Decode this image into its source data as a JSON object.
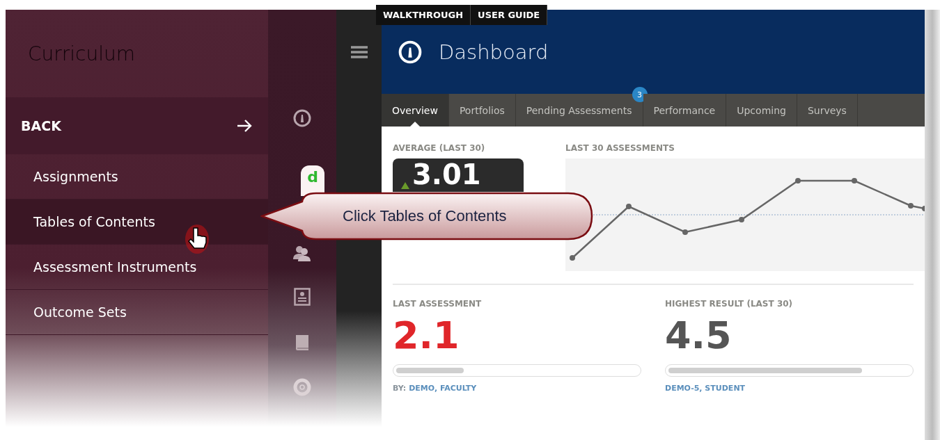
{
  "menu": {
    "title": "Curriculum",
    "back": "BACK",
    "items": [
      {
        "label": "Assignments",
        "selected": false
      },
      {
        "label": "Tables of Contents",
        "selected": true
      },
      {
        "label": "Assessment Instruments",
        "selected": false
      },
      {
        "label": "Outcome Sets",
        "selected": false
      }
    ]
  },
  "top_links": [
    "WALKTHROUGH",
    "USER GUIDE"
  ],
  "header": {
    "title": "Dashboard"
  },
  "tabs": [
    {
      "label": "Overview",
      "selected": true
    },
    {
      "label": "Portfolios",
      "selected": false
    },
    {
      "label": "Pending Assessments",
      "selected": false,
      "badge": "3"
    },
    {
      "label": "Performance",
      "selected": false
    },
    {
      "label": "Upcoming",
      "selected": false
    },
    {
      "label": "Surveys",
      "selected": false
    }
  ],
  "average": {
    "label": "AVERAGE (LAST 30)",
    "value": "3.01"
  },
  "chart": {
    "title": "LAST 30 ASSESSMENTS"
  },
  "stats": [
    {
      "label": "LAST ASSESSMENT",
      "value": "2.1",
      "kind": "low",
      "level": 0.28,
      "by_prefix": "BY:",
      "by": "DEMO, FACULTY"
    },
    {
      "label": "HIGHEST RESULT (LAST 30)",
      "value": "4.5",
      "kind": "high",
      "level": 0.8,
      "by": "DEMO-5, STUDENT"
    }
  ],
  "callout": {
    "text": "Click Tables of Contents",
    "tab": "d"
  }
}
